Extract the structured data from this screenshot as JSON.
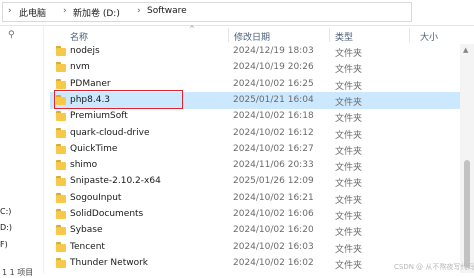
{
  "address_bar": {
    "segments": [
      "此电脑",
      "新加卷 (D:)",
      "Software"
    ],
    "separator": "›"
  },
  "nav": {
    "pin_icon": "pin-icon",
    "drives": [
      "C:)",
      "D:)",
      "F)"
    ]
  },
  "status_bar": {
    "text": "1 1 项目"
  },
  "columns": {
    "name": "名称",
    "date": "修改日期",
    "type": "类型",
    "size": "大小"
  },
  "files": [
    {
      "name": "nodejs",
      "date": "2024/12/19 18:03",
      "type": "文件夹",
      "selected": false
    },
    {
      "name": "nvm",
      "date": "2024/10/19 20:26",
      "type": "文件夹",
      "selected": false
    },
    {
      "name": "PDManer",
      "date": "2024/10/02 16:25",
      "type": "文件夹",
      "selected": false
    },
    {
      "name": "php8.4.3",
      "date": "2025/01/21 16:04",
      "type": "文件夹",
      "selected": true
    },
    {
      "name": "PremiumSoft",
      "date": "2024/10/02 16:18",
      "type": "文件夹",
      "selected": false
    },
    {
      "name": "quark-cloud-drive",
      "date": "2024/10/02 16:12",
      "type": "文件夹",
      "selected": false
    },
    {
      "name": "QuickTime",
      "date": "2024/10/02 16:27",
      "type": "文件夹",
      "selected": false
    },
    {
      "name": "shimo",
      "date": "2024/11/06 20:33",
      "type": "文件夹",
      "selected": false
    },
    {
      "name": "Snipaste-2.10.2-x64",
      "date": "2025/01/26 12:09",
      "type": "文件夹",
      "selected": false
    },
    {
      "name": "SogouInput",
      "date": "2024/10/02 16:21",
      "type": "文件夹",
      "selected": false
    },
    {
      "name": "SolidDocuments",
      "date": "2024/10/02 16:06",
      "type": "文件夹",
      "selected": false
    },
    {
      "name": "Sybase",
      "date": "2024/10/02 16:20",
      "type": "文件夹",
      "selected": false
    },
    {
      "name": "Tencent",
      "date": "2024/10/02 16:03",
      "type": "文件夹",
      "selected": false
    },
    {
      "name": "Thunder Network",
      "date": "2024/10/02 16:02",
      "type": "文件夹",
      "selected": false
    }
  ],
  "watermark": "CSDN @ 从不熬夜写代码",
  "colors": {
    "selection": "#cce8ff",
    "highlight_box": "#e0232d",
    "folder": "#f6c94a"
  }
}
